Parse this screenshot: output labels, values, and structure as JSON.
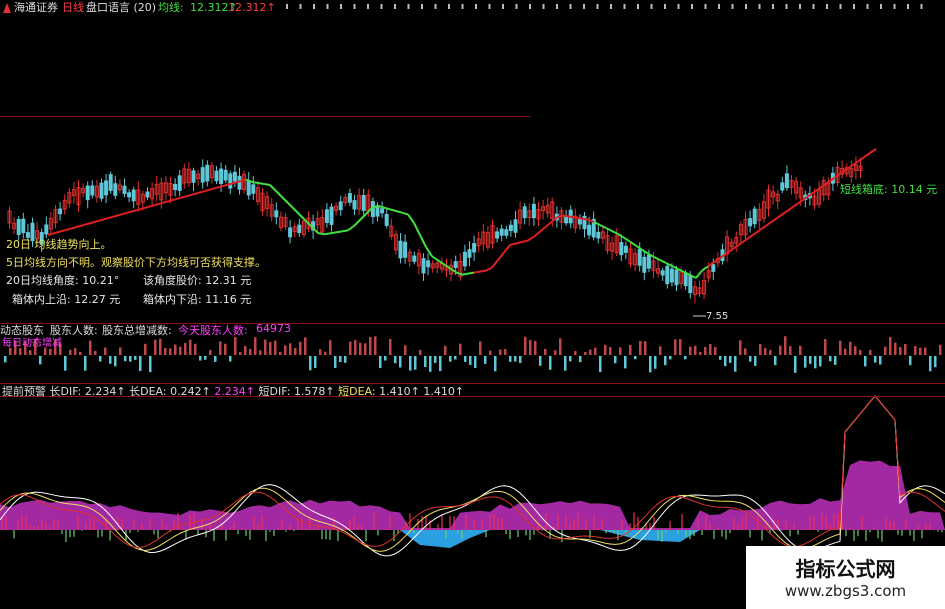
{
  "header": {
    "broker": "海通证券",
    "period": "日线",
    "formula": "盘口语言 (20)",
    "ma_label": "均线:",
    "ma_value1": "12.312↑",
    "ma_value2": "12.312↑"
  },
  "main_panel": {
    "line1": "20日 均线趋势向上。",
    "line2": "5日均线方向不明。观察股价下方均线可否获得支撑。",
    "angle_label": "20日均线角度:",
    "angle_value": "10.21°",
    "angle_price_label": "该角度股价:",
    "angle_price_value": "12.31 元",
    "box_upper_label": "箱体内上沿:",
    "box_upper_value": "12.27 元",
    "box_lower_label": "箱体内下沿:",
    "box_lower_value": "11.16 元",
    "short_box_label": "短线箱底:",
    "short_box_value": "10.14 元",
    "low_marker": "7.55"
  },
  "shareholder_panel": {
    "title": "动态股东",
    "holders_label": "股东人数:",
    "total_change_label": "股东总增减数:",
    "today_label": "今天股东人数:",
    "today_value": "64973",
    "sub_label": "每日动态增减"
  },
  "macd_panel": {
    "title": "提前预警",
    "long_dif_label": "长DIF:",
    "long_dif_value": "2.234↑",
    "long_dea_label": "长DEA:",
    "long_dea_value": "0.242↑",
    "extra_value": "2.234↑",
    "short_dif_label": "短DIF:",
    "short_dif_value": "1.578↑",
    "short_dea_label": "短DEA:",
    "short_dea_value": "1.410↑",
    "short_dea_value2": "1.410↑"
  },
  "watermark": {
    "title": "指标公式网",
    "url": "www.zbgs3.com"
  },
  "colors": {
    "up": "#e03030",
    "down": "#5fc8d8",
    "ma_red": "#e02020",
    "ma_green": "#40e040",
    "area_magenta": "#c030c0",
    "area_blue": "#2aa0e0"
  }
}
